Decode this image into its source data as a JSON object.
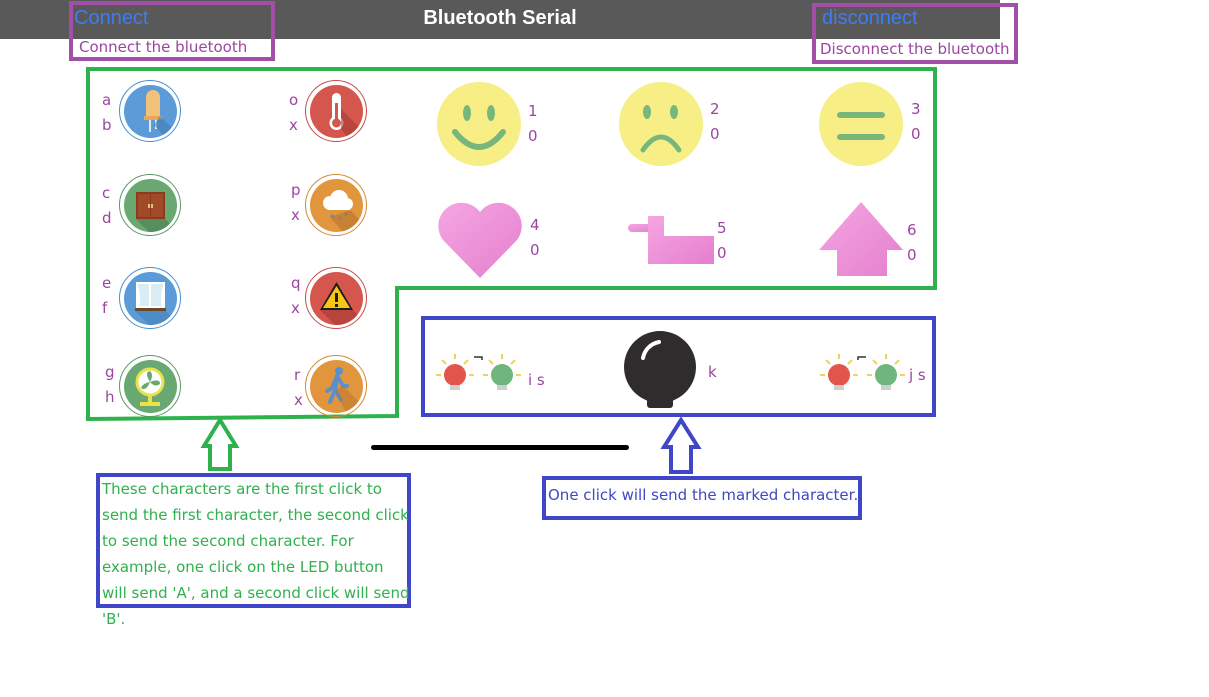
{
  "header": {
    "title": "Bluetooth Serial",
    "connect_label": "Connect",
    "disconnect_label": "disconnect"
  },
  "annotations": {
    "connect_note": "Connect the bluetooth",
    "disconnect_note": "Disconnect the bluetooth",
    "toggle_note": "These characters are the first click to send the first character, the second click to send the second character. For example, one click on the LED button will send 'A', and a second click will send 'B'.",
    "single_note": "One click will send the marked character."
  },
  "toggle_buttons": [
    {
      "icon": "led-icon",
      "first": "a",
      "second": "b"
    },
    {
      "icon": "cabinet-door-icon",
      "first": "c",
      "second": "d"
    },
    {
      "icon": "window-curtain-icon",
      "first": "e",
      "second": "f"
    },
    {
      "icon": "fan-icon",
      "first": "g",
      "second": "h"
    },
    {
      "icon": "thermometer-icon",
      "first": "o",
      "second": "x"
    },
    {
      "icon": "weather-cloud-icon",
      "first": "p",
      "second": "x"
    },
    {
      "icon": "warning-icon",
      "first": "q",
      "second": "x"
    },
    {
      "icon": "walking-person-icon",
      "first": "r",
      "second": "x"
    }
  ],
  "gesture_buttons": [
    {
      "icon": "smile-face-icon",
      "first": "1",
      "second": "0"
    },
    {
      "icon": "sad-face-icon",
      "first": "2",
      "second": "0"
    },
    {
      "icon": "neutral-face-icon",
      "first": "3",
      "second": "0"
    },
    {
      "icon": "heart-icon",
      "first": "4",
      "second": "0"
    },
    {
      "icon": "duck-icon",
      "first": "5",
      "second": "0"
    },
    {
      "icon": "up-arrow-icon",
      "first": "6",
      "second": "0"
    }
  ],
  "single_buttons": {
    "left_lights": "i s",
    "center": "k",
    "right_lights": "j s"
  },
  "colors": {
    "topbar": "#595959",
    "link": "#3d7cf2",
    "annotation_purple": "#a24fa8",
    "annotation_green": "#2fb14d",
    "annotation_blue": "#3f46c7"
  }
}
